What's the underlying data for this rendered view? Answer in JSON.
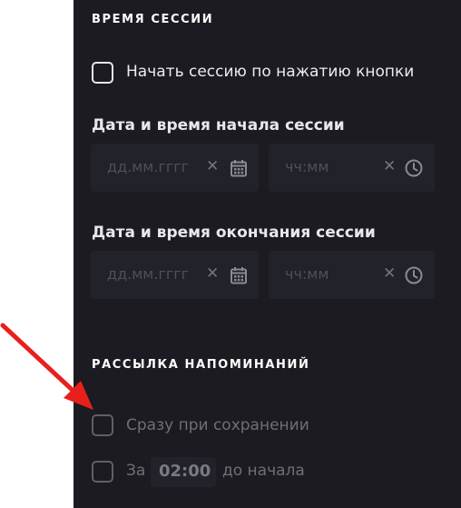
{
  "session_time": {
    "title": "ВРЕМЯ СЕССИИ",
    "start_on_button": {
      "label": "Начать сессию по нажатию кнопки",
      "checked": false
    },
    "start": {
      "label": "Дата и время начала сессии",
      "date_placeholder": "дд.мм.гггг",
      "time_placeholder": "чч:мм"
    },
    "end": {
      "label": "Дата и время окончания сессии",
      "date_placeholder": "дд.мм.гггг",
      "time_placeholder": "чч:мм"
    },
    "clear_glyph": "✕"
  },
  "reminders": {
    "title": "РАССЫЛКА НАПОМИНАНИЙ",
    "on_save": {
      "label": "Сразу при сохранении",
      "checked": false
    },
    "before_start": {
      "prefix": "За",
      "value": "02:00",
      "suffix": "до начала",
      "checked": false
    }
  },
  "icons": {
    "calendar": "calendar-icon",
    "clock": "clock-icon",
    "clear": "close-icon",
    "annotation_arrow": "arrow-icon"
  },
  "colors": {
    "panel_bg": "#1b1b21",
    "input_bg": "#22222a",
    "text": "#ececef",
    "muted": "#6f6f78",
    "annotation_arrow": "#e8201c"
  }
}
